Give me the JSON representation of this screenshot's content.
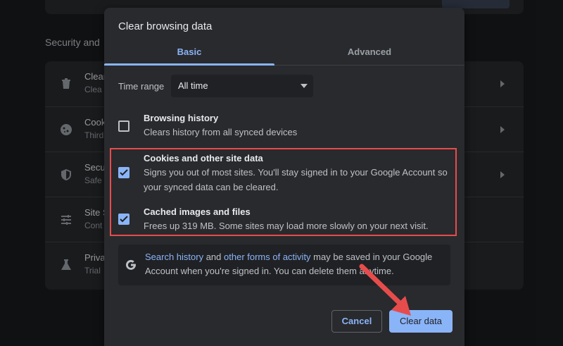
{
  "background": {
    "section_heading": "Security and",
    "rows": [
      {
        "icon": "trash-icon",
        "title": "Clear",
        "subtitle": "Clea"
      },
      {
        "icon": "cookie-icon",
        "title": "Cook",
        "subtitle": "Third"
      },
      {
        "icon": "shield-icon",
        "title": "Secu",
        "subtitle": "Safe"
      },
      {
        "icon": "sliders-icon",
        "title": "Site S",
        "subtitle": "Cont"
      },
      {
        "icon": "flask-icon",
        "title": "Priva",
        "subtitle": "Trial"
      }
    ]
  },
  "dialog": {
    "title": "Clear browsing data",
    "tabs": [
      {
        "label": "Basic",
        "selected": true
      },
      {
        "label": "Advanced",
        "selected": false
      }
    ],
    "time_range": {
      "label": "Time range",
      "value": "All time"
    },
    "options": [
      {
        "title": "Browsing history",
        "description": "Clears history from all synced devices",
        "checked": false
      },
      {
        "title": "Cookies and other site data",
        "description": "Signs you out of most sites. You'll stay signed in to your Google Account so your synced data can be cleared.",
        "checked": true
      },
      {
        "title": "Cached images and files",
        "description": "Frees up 319 MB. Some sites may load more slowly on your next visit.",
        "checked": true
      }
    ],
    "notice": {
      "link1": "Search history",
      "and": " and ",
      "link2": "other forms of activity",
      "rest": " may be saved in your Google Account when you're signed in. You can delete them anytime."
    },
    "buttons": {
      "cancel": "Cancel",
      "clear": "Clear data"
    }
  },
  "colors": {
    "accent": "#8ab4f8",
    "highlight": "#e74c4c",
    "dialog_bg": "#292a2d"
  }
}
